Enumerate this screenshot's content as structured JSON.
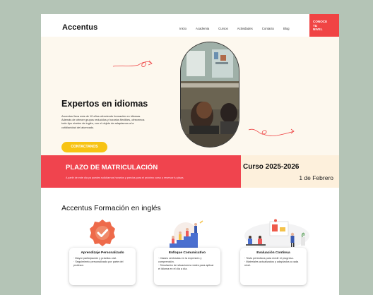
{
  "header": {
    "logo": "Accentus",
    "nav": [
      "Inicio",
      "Academia",
      "Cursos",
      "Actividades",
      "Contacto",
      "Blog"
    ],
    "cta": [
      "CONOCE",
      "TU",
      "NIVEL"
    ]
  },
  "hero": {
    "title": "Expertos en idiomas",
    "text": "Accentus lleva más de 10 años ofreciendo formación en idiomas. Además de ofrecer grupos reducidos y horarios flexibles, ofrecemos todo tipo niveles de inglés, con el objeto de adaptarnos a la cotidianidad del alumnado.",
    "button": "CONTACTANOS"
  },
  "banner": {
    "title": "PLAZO DE MATRICULACIÓN",
    "subtitle": "A partir de este día ya puedes solicitarnos horarios y precios para el próximo curso y reservar tu plaza.",
    "course": "Curso 2025-2026",
    "date": "1 de Febrero"
  },
  "section": {
    "title": "Accentus Formación en inglés",
    "cards": [
      {
        "title": "Aprendizaje Personalizado",
        "lines": [
          "· Mayor participación y práctica oral.",
          "· Seguimiento personalizado por parte del profesor."
        ]
      },
      {
        "title": "Enfoque Comunicativo",
        "lines": [
          "· Clases centradas en la expresión y comprensión.",
          "· Simulación de situaciones reales para aplicar el idioma en el día a día."
        ]
      },
      {
        "title": "Evaluación Continua",
        "lines": [
          "· Tests periódicos para medir el progreso.",
          "· Materiales actualizados y adaptados a cada nivel."
        ]
      }
    ]
  },
  "colors": {
    "accent": "#f04444",
    "cream": "#fdf8ee",
    "yellow": "#f7c313",
    "background": "#b4c4b6"
  }
}
